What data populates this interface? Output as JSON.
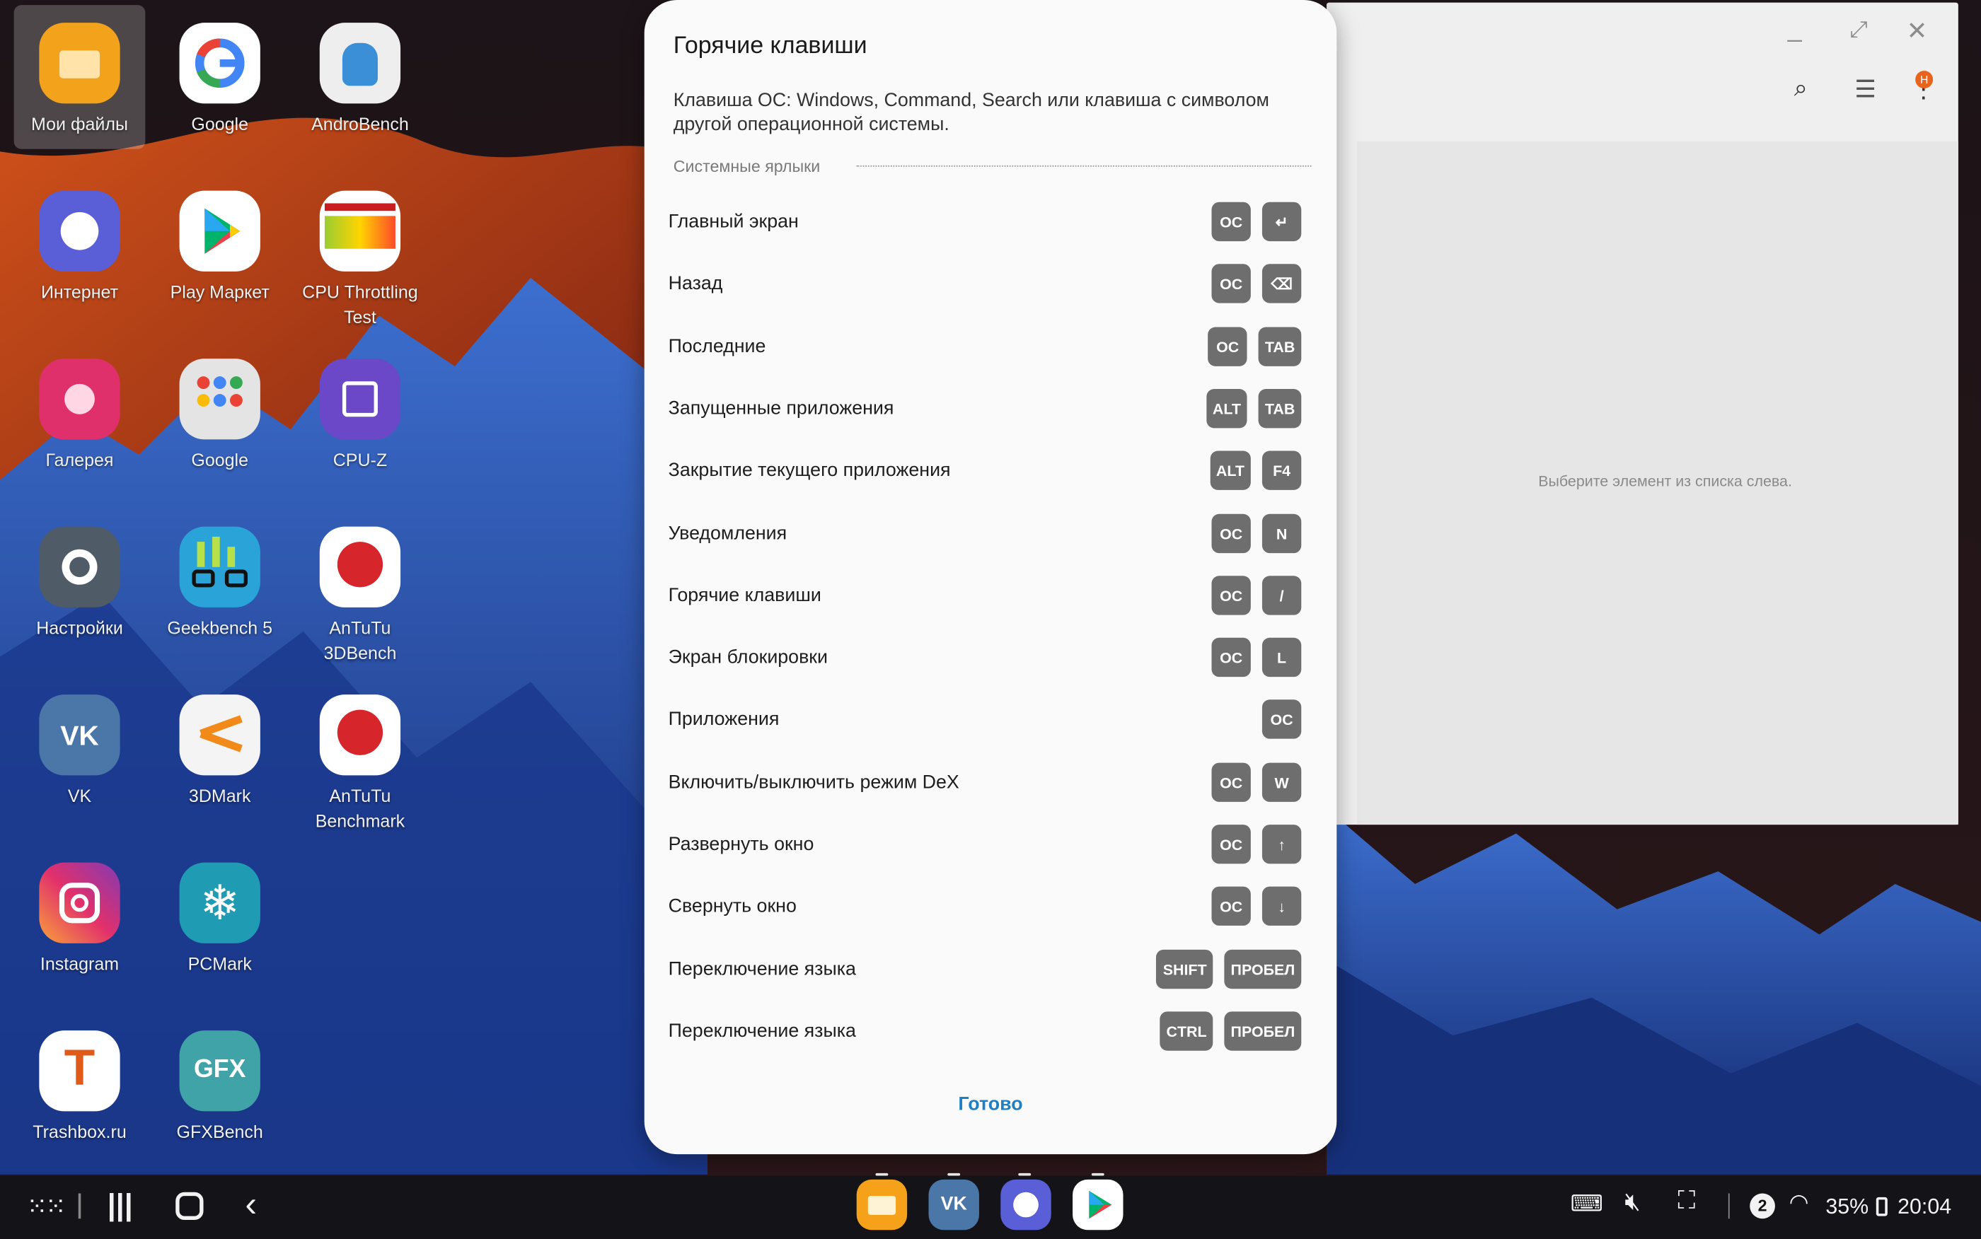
{
  "desktop": {
    "icons": [
      {
        "label": "Мои файлы",
        "icon": "folder-icon"
      },
      {
        "label": "Google",
        "icon": "google-g-icon"
      },
      {
        "label": "AndroBench",
        "icon": "android-robot-icon"
      },
      {
        "label": "Интернет",
        "icon": "planet-browser-icon"
      },
      {
        "label": "Play Маркет",
        "icon": "play-store-icon"
      },
      {
        "label": "CPU Throttling Test",
        "icon": "cpu-throttling-chart-icon"
      },
      {
        "label": "Галерея",
        "icon": "flower-gallery-icon"
      },
      {
        "label": "Google",
        "icon": "google-apps-folder-icon"
      },
      {
        "label": "CPU-Z",
        "icon": "cpu-chip-icon"
      },
      {
        "label": "Настройки",
        "icon": "gear-icon"
      },
      {
        "label": "Geekbench 5",
        "icon": "geekbench-glasses-icon"
      },
      {
        "label": "AnTuTu 3DBench",
        "icon": "antutu-3d-icon"
      },
      {
        "label": "VK",
        "icon": "vk-icon"
      },
      {
        "label": "3DMark",
        "icon": "3dmark-icon"
      },
      {
        "label": "AnTuTu Benchmark",
        "icon": "antutu-icon"
      },
      {
        "label": "Instagram",
        "icon": "instagram-icon"
      },
      {
        "label": "PCMark",
        "icon": "snowflake-pcmark-icon"
      },
      {
        "label": "Trashbox.ru",
        "icon": "trashbox-icon"
      },
      {
        "label": "GFXBench",
        "icon": "gfx-icon"
      }
    ]
  },
  "background_window": {
    "placeholder_text": "Выберите элемент из списка слева.",
    "notification_badge": "H"
  },
  "dialog": {
    "title": "Горячие клавиши",
    "description": "Клавиша ОС: Windows, Command, Search или клавиша с символом другой операционной системы.",
    "section_title": "Системные ярлыки",
    "shortcuts": [
      {
        "label": "Главный экран",
        "keys": [
          "ОС",
          "↵"
        ]
      },
      {
        "label": "Назад",
        "keys": [
          "ОС",
          "⌫"
        ]
      },
      {
        "label": "Последние",
        "keys": [
          "ОС",
          "TAB"
        ]
      },
      {
        "label": "Запущенные приложения",
        "keys": [
          "ALT",
          "TAB"
        ]
      },
      {
        "label": "Закрытие текущего приложения",
        "keys": [
          "ALT",
          "F4"
        ]
      },
      {
        "label": "Уведомления",
        "keys": [
          "ОС",
          "N"
        ]
      },
      {
        "label": "Горячие клавиши",
        "keys": [
          "ОС",
          "/"
        ]
      },
      {
        "label": "Экран блокировки",
        "keys": [
          "ОС",
          "L"
        ]
      },
      {
        "label": "Приложения",
        "keys": [
          "ОС"
        ]
      },
      {
        "label": "Включить/выключить режим DeX",
        "keys": [
          "ОС",
          "W"
        ]
      },
      {
        "label": "Развернуть окно",
        "keys": [
          "ОС",
          "↑"
        ]
      },
      {
        "label": "Свернуть окно",
        "keys": [
          "ОС",
          "↓"
        ]
      },
      {
        "label": "Переключение языка",
        "keys": [
          "SHIFT",
          "ПРОБЕЛ"
        ]
      },
      {
        "label": "Переключение языка",
        "keys": [
          "CTRL",
          "ПРОБЕЛ"
        ]
      }
    ],
    "done_label": "Готово"
  },
  "taskbar": {
    "dock_apps": [
      "files-icon",
      "vk-icon",
      "internet-icon",
      "play-store-icon"
    ],
    "notification_count": "2",
    "battery": "35%",
    "time": "20:04"
  },
  "colors": {
    "accent": "#1f7fc4",
    "key_bg": "#6e6e6e",
    "dialog_bg": "#fafafa"
  }
}
